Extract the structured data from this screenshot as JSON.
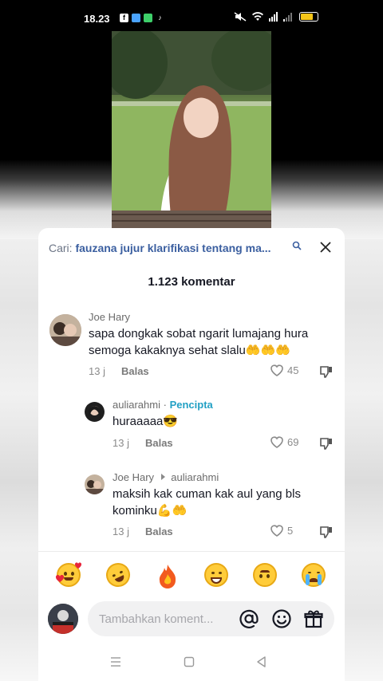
{
  "status_bar": {
    "time": "18.23",
    "colors": {
      "battery": "#f5c518"
    }
  },
  "search": {
    "label": "Cari:",
    "query": "fauzana jujur klarifikasi tentang ma..."
  },
  "comments_header": {
    "count_label": "1.123 komentar"
  },
  "comments": [
    {
      "author": "Joe Hary",
      "text": "sapa dongkak sobat ngarit lumajang hura semoga kakaknya sehat slalu🤲🤲🤲",
      "time": "13 j",
      "reply_label": "Balas",
      "likes": "45"
    },
    {
      "author": "auliarahmi",
      "separator": "·",
      "creator_badge": "Pencipta",
      "text": "huraaaaa😎",
      "time": "13 j",
      "reply_label": "Balas",
      "likes": "69"
    },
    {
      "author": "Joe Hary",
      "reply_to": "auliarahmi",
      "text": "maksih kak cuman kak aul yang bls kominku💪🤲",
      "time": "13 j",
      "reply_label": "Balas",
      "likes": "5"
    }
  ],
  "emoji_bar": [
    "smiling-face-with-hearts",
    "rolling-on-floor-laughing",
    "fire",
    "beaming-grin",
    "upside-down-face",
    "loudly-crying-face"
  ],
  "composer": {
    "placeholder": "Tambahkan koment...",
    "icons": [
      "at-icon",
      "emoji-icon",
      "gift-icon"
    ]
  },
  "nav": {
    "icons": [
      "menu-icon",
      "home-icon",
      "back-icon"
    ]
  }
}
